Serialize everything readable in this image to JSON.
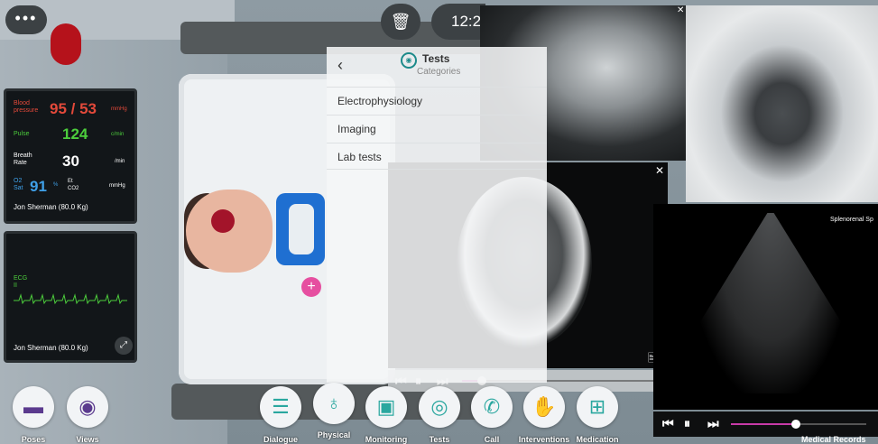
{
  "top": {
    "menu_icon": "•••",
    "clock_text": "12:2"
  },
  "vitals": {
    "bp_label": "Blood pressure",
    "bp_value": "95 / 53",
    "bp_unit": "mmHg",
    "pulse_label": "Pulse",
    "pulse_value": "124",
    "pulse_unit": "c/min",
    "breath_label": "Breath Rate",
    "breath_value": "30",
    "breath_unit": "/min",
    "o2_label": "O2 Sat",
    "o2_value": "91",
    "o2_unit": "%",
    "co2_label": "Et CO2",
    "co2_unit": "mmHg",
    "patient": "Jon Sherman (80.0 Kg)"
  },
  "ecg": {
    "label": "ECG II",
    "patient": "Jon Sherman (80.0 Kg)"
  },
  "tests": {
    "title": "Tests",
    "subtitle": "Categories",
    "categories": [
      "Electrophysiology",
      "Imaging",
      "Lab tests"
    ]
  },
  "ultrasound": {
    "title": "Splenorenal Sp",
    "progress": 0.48
  },
  "ct": {
    "progress": 0.1
  },
  "toolbar": {
    "poses": "Poses",
    "views": "Views",
    "dialogue": "Dialogue",
    "physical": "Physical",
    "monitoring": "Monitoring",
    "tests": "Tests",
    "call": "Call",
    "interventions": "Interventions",
    "medication": "Medication",
    "medical_records": "Medical Records"
  },
  "colors": {
    "accent": "#2aa79f",
    "bp": "#e3493a",
    "pulse": "#4ccd3c",
    "o2": "#3fa0e8"
  }
}
